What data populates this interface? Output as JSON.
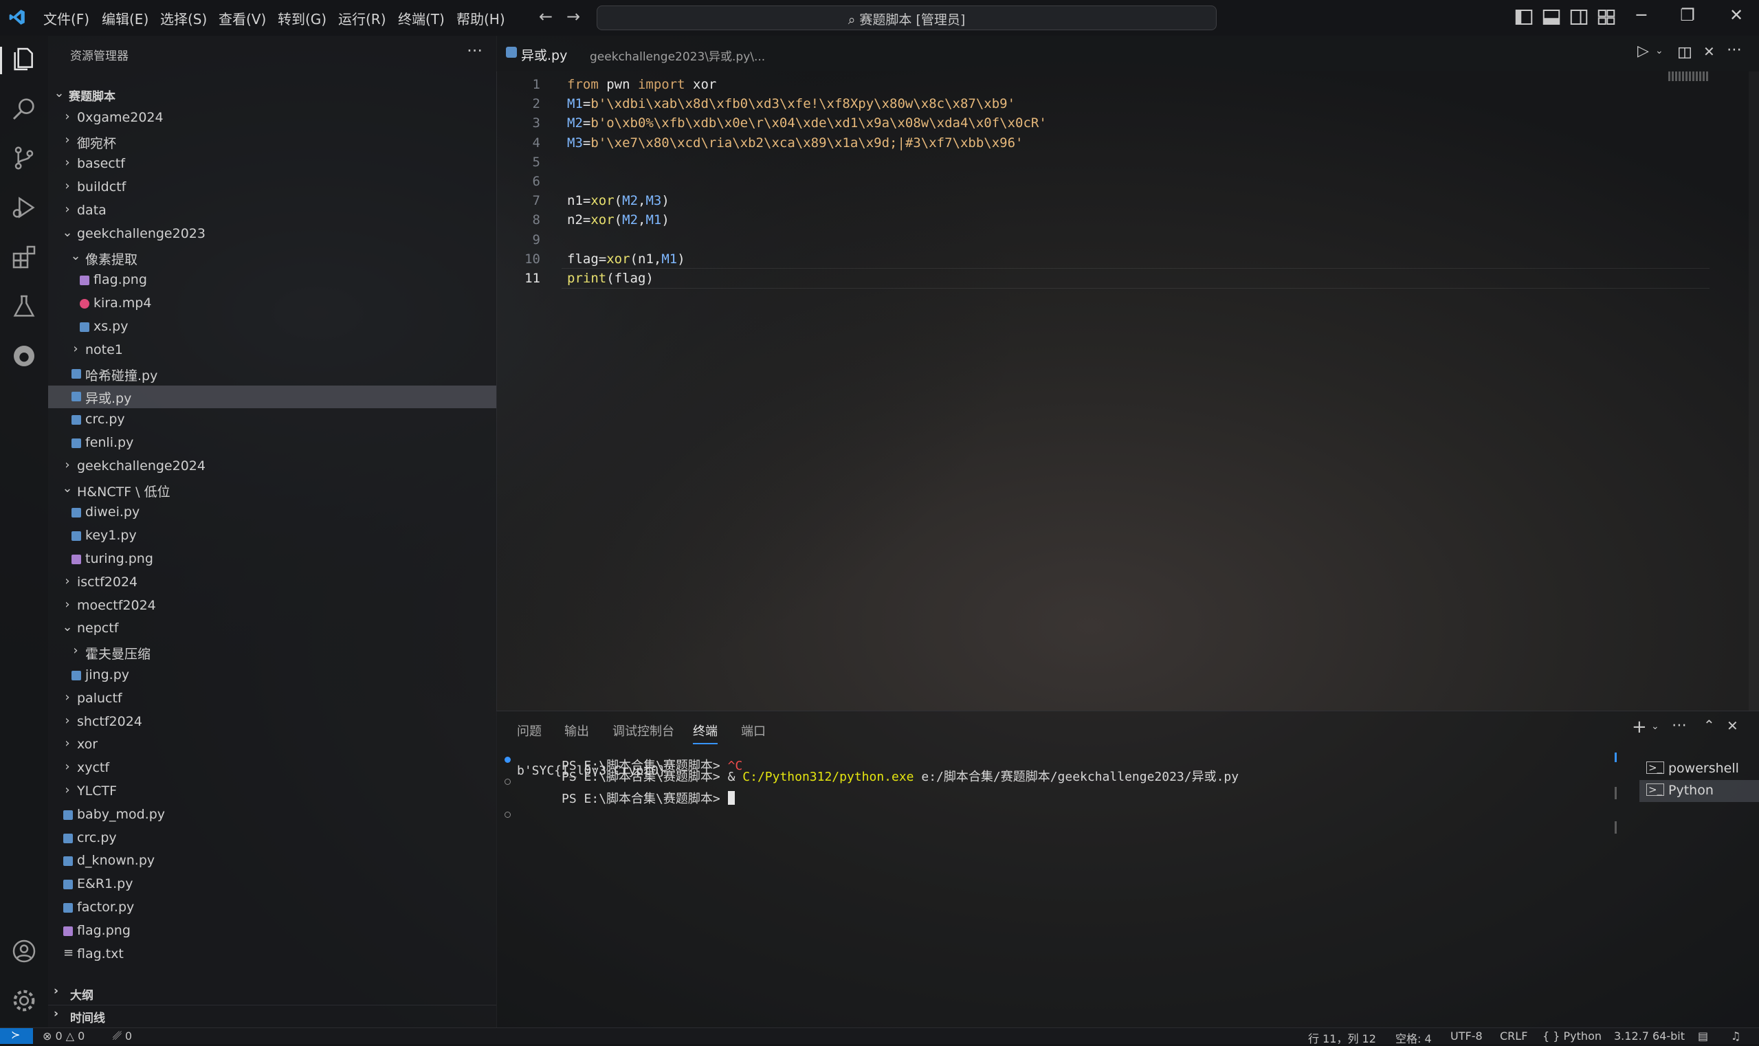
{
  "titlebar": {
    "menus": [
      "文件(F)",
      "编辑(E)",
      "选择(S)",
      "查看(V)",
      "转到(G)",
      "运行(R)",
      "终端(T)",
      "帮助(H)"
    ],
    "search_text": "赛题脚本 [管理员]"
  },
  "sidebar": {
    "title": "资源管理器",
    "more": "···",
    "tree": [
      {
        "label": "赛题脚本",
        "kind": "root",
        "bold": true
      },
      {
        "label": "0xgame2024",
        "kind": "folder"
      },
      {
        "label": "御宛杯",
        "kind": "folder"
      },
      {
        "label": "basectf",
        "kind": "folder"
      },
      {
        "label": "buildctf",
        "kind": "folder"
      },
      {
        "label": "data",
        "kind": "folder"
      },
      {
        "label": "geekchallenge2023",
        "kind": "folder-open"
      },
      {
        "label": "像素提取",
        "kind": "folder-open"
      },
      {
        "label": "flag.png",
        "kind": "image"
      },
      {
        "label": "kira.mp4",
        "kind": "video"
      },
      {
        "label": "xs.py",
        "kind": "python"
      },
      {
        "label": "note1",
        "kind": "folder"
      },
      {
        "label": "哈希碰撞.py",
        "kind": "python"
      },
      {
        "label": "异或.py",
        "kind": "python",
        "selected": true
      },
      {
        "label": "crc.py",
        "kind": "python"
      },
      {
        "label": "fenli.py",
        "kind": "python"
      },
      {
        "label": "geekchallenge2024",
        "kind": "folder"
      },
      {
        "label": "H&NCTF \\ 低位",
        "kind": "folder-open"
      },
      {
        "label": "diwei.py",
        "kind": "python"
      },
      {
        "label": "key1.py",
        "kind": "python"
      },
      {
        "label": "turing.png",
        "kind": "image"
      },
      {
        "label": "isctf2024",
        "kind": "folder"
      },
      {
        "label": "moectf2024",
        "kind": "folder"
      },
      {
        "label": "nepctf",
        "kind": "folder-open"
      },
      {
        "label": "霍夫曼压缩",
        "kind": "folder"
      },
      {
        "label": "jing.py",
        "kind": "python"
      },
      {
        "label": "paluctf",
        "kind": "folder"
      },
      {
        "label": "shctf2024",
        "kind": "folder"
      },
      {
        "label": "xor",
        "kind": "folder"
      },
      {
        "label": "xyctf",
        "kind": "folder"
      },
      {
        "label": "YLCTF",
        "kind": "folder"
      },
      {
        "label": "baby_mod.py",
        "kind": "python"
      },
      {
        "label": "crc.py",
        "kind": "python"
      },
      {
        "label": "d_known.py",
        "kind": "python"
      },
      {
        "label": "E&R1.py",
        "kind": "python"
      },
      {
        "label": "factor.py",
        "kind": "python"
      },
      {
        "label": "flag.png",
        "kind": "image"
      },
      {
        "label": "flag.txt",
        "kind": "text"
      }
    ],
    "sections": [
      "大纲",
      "时间线"
    ]
  },
  "editor": {
    "tab_file": "异或.py",
    "tab_path": "geekchallenge2023\\异或.py\\...",
    "line_numbers": [
      "1",
      "2",
      "3",
      "4",
      "5",
      "6",
      "7",
      "8",
      "9",
      "10",
      "11"
    ],
    "lines": [
      [
        [
          "kw",
          "from "
        ],
        [
          "id",
          "pwn "
        ],
        [
          "kw",
          "import "
        ],
        [
          "id",
          "xor"
        ]
      ],
      [
        [
          "v",
          "M1"
        ],
        [
          "op",
          "="
        ],
        [
          "s",
          "b'\\xdbi\\xab\\x8d\\xfb0\\xd3\\xfe!\\xf8Xpy\\x80w\\x8c\\x87\\xb9'"
        ]
      ],
      [
        [
          "v",
          "M2"
        ],
        [
          "op",
          "="
        ],
        [
          "s",
          "b'o\\xb0%\\xfb\\xdb\\x0e\\r\\x04\\xde\\xd1\\x9a\\x08w\\xda4\\x0f\\x0cR'"
        ]
      ],
      [
        [
          "v",
          "M3"
        ],
        [
          "op",
          "="
        ],
        [
          "s",
          "b'\\xe7\\x80\\xcd\\ria\\xb2\\xca\\x89\\x1a\\x9d;|#3\\xf7\\xbb\\x96'"
        ]
      ],
      [],
      [],
      [
        [
          "id",
          "n1"
        ],
        [
          "op",
          "="
        ],
        [
          "fn",
          "xor"
        ],
        [
          "op",
          "("
        ],
        [
          "v",
          "M2"
        ],
        [
          "op",
          ","
        ],
        [
          "v",
          "M3"
        ],
        [
          "op",
          ")"
        ]
      ],
      [
        [
          "id",
          "n2"
        ],
        [
          "op",
          "="
        ],
        [
          "fn",
          "xor"
        ],
        [
          "op",
          "("
        ],
        [
          "v",
          "M2"
        ],
        [
          "op",
          ","
        ],
        [
          "v",
          "M1"
        ],
        [
          "op",
          ")"
        ]
      ],
      [],
      [
        [
          "id",
          "flag"
        ],
        [
          "op",
          "="
        ],
        [
          "fn",
          "xor"
        ],
        [
          "op",
          "("
        ],
        [
          "id",
          "n1"
        ],
        [
          "op",
          ","
        ],
        [
          "v",
          "M1"
        ],
        [
          "op",
          ")"
        ]
      ],
      [
        [
          "fn",
          "print"
        ],
        [
          "op",
          "("
        ],
        [
          "id",
          "flag"
        ],
        [
          "op",
          ")"
        ]
      ]
    ]
  },
  "panel": {
    "tabs": [
      "问题",
      "输出",
      "调试控制台",
      "终端",
      "端口"
    ],
    "active_tab": "终端",
    "terminal_lines": [
      {
        "prompt": "PS E:\\脚本合集\\赛题脚本> ",
        "cmd": "^C"
      },
      {
        "prompt": "PS E:\\脚本合集\\赛题脚本> ",
        "amp": "& ",
        "exe": "C:/Python312/python.exe",
        "args": " e:/脚本合集/赛题脚本/geekchallenge2023/异或.py"
      },
      {
        "output": "b'SYC{I_l0v3_Crypt0}'"
      },
      {
        "prompt": "PS E:\\脚本合集\\赛题脚本> "
      }
    ],
    "terminals": [
      "powershell",
      "Python"
    ]
  },
  "statusbar": {
    "problems": "⊗ 0 △ 0",
    "ports": "␥ 0",
    "position": "行 11，列 12",
    "spaces": "空格: 4",
    "encoding": "UTF-8",
    "eol": "CRLF",
    "language": "{ } Python",
    "interpreter": "3.12.7 64-bit"
  },
  "colors": {
    "accent": "#3794ff",
    "selection": "#50525a"
  }
}
